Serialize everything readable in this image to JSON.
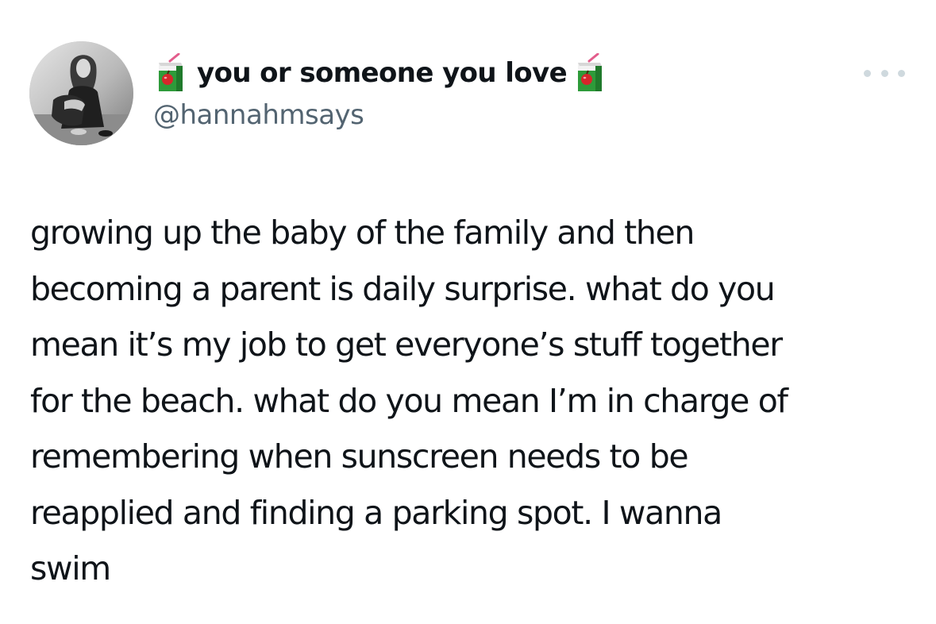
{
  "author": {
    "display_name": "you or someone you love",
    "handle": "@hannahmsays",
    "name_icon": "apple-juice-box-icon",
    "avatar": "avatar"
  },
  "tweet": {
    "lines": [
      "growing up the baby of the family and then",
      "becoming a parent is daily surprise. what do you",
      "mean it’s my job to get everyone’s stuff together",
      "for the beach. what do you mean I’m in charge of",
      "remembering when sunscreen needs to be",
      "reapplied and finding a parking spot. I wanna",
      "swim"
    ]
  },
  "more_icon": "more-dots-icon",
  "colors": {
    "text": "#0f1419",
    "secondary_text": "#536471",
    "more_dots": "#cfd9de",
    "background": "#ffffff",
    "juice_green": "#2e9b3a",
    "juice_red": "#d6262b"
  }
}
